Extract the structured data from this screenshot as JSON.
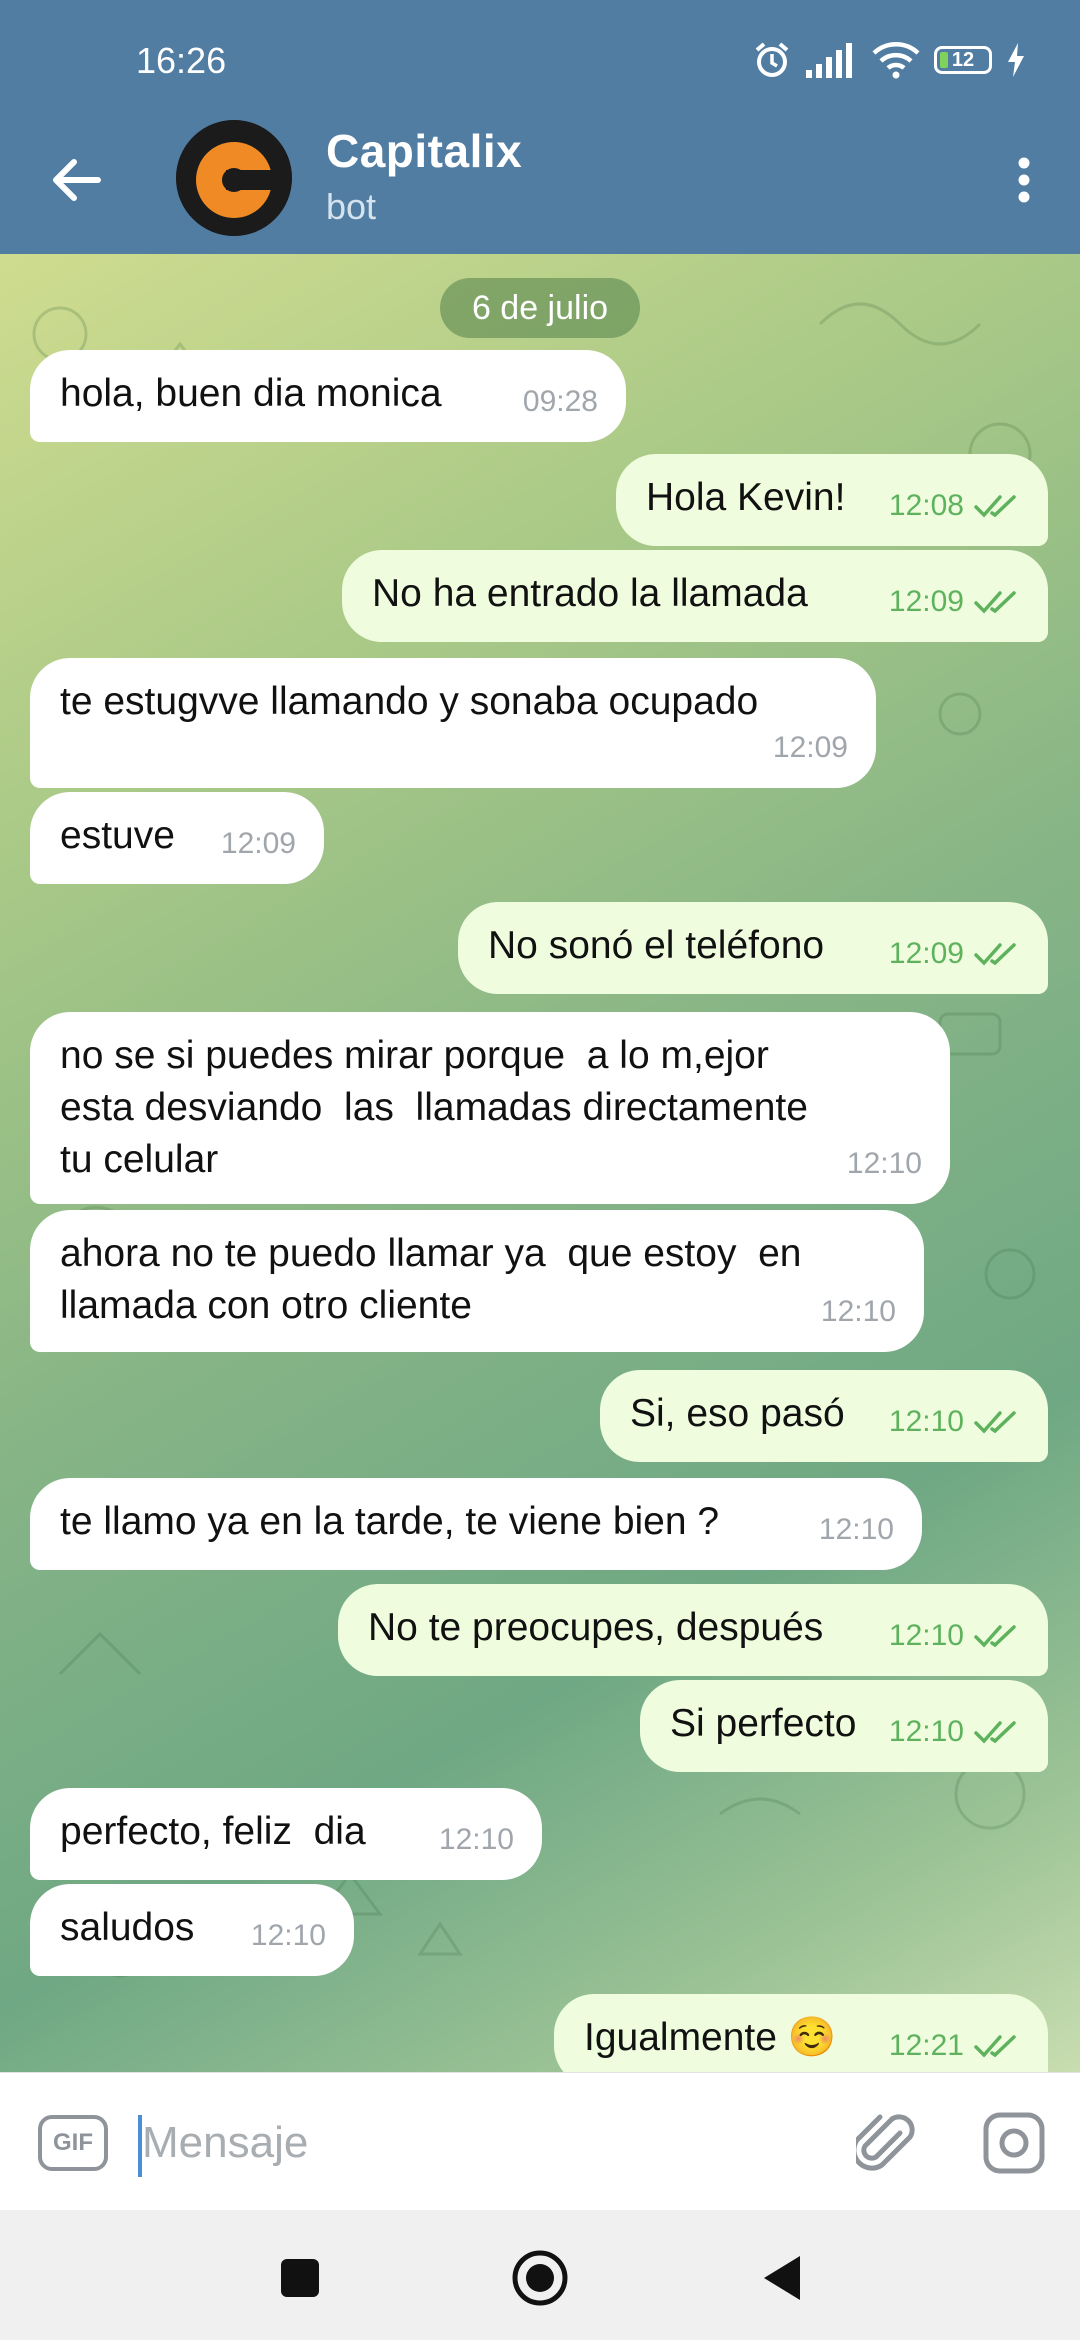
{
  "status_bar": {
    "time": "16:26",
    "battery": "12",
    "icons": [
      "alarm-icon",
      "signal-icon",
      "wifi-icon",
      "battery-icon",
      "charging-icon"
    ]
  },
  "header": {
    "title": "Capitalix",
    "subtitle": "bot",
    "back_icon": "arrow-left-icon",
    "menu_icon": "more-vertical-icon",
    "accent": "#517da2"
  },
  "chat": {
    "date": "6 de julio",
    "messages": [
      {
        "dir": "in",
        "text": "hola, buen dia monica",
        "time": "09:28"
      },
      {
        "dir": "out",
        "text": "Hola Kevin!",
        "time": "12:08",
        "read": true
      },
      {
        "dir": "out",
        "text": "No ha entrado la llamada",
        "time": "12:09",
        "read": true
      },
      {
        "dir": "in",
        "text": "te estugvve llamando y sonaba ocupado",
        "time": "12:09"
      },
      {
        "dir": "in",
        "text": "estuve",
        "time": "12:09"
      },
      {
        "dir": "out",
        "text": "No sonó el teléfono",
        "time": "12:09",
        "read": true
      },
      {
        "dir": "in",
        "text": "no se si puedes mirar porque  a lo m,ejor\nesta desviando  las  llamadas directamente\ntu celular",
        "time": "12:10"
      },
      {
        "dir": "in",
        "text": "ahora no te puedo llamar ya  que estoy  en\nllamada con otro cliente",
        "time": "12:10"
      },
      {
        "dir": "out",
        "text": "Si, eso pasó",
        "time": "12:10",
        "read": true
      },
      {
        "dir": "in",
        "text": "te llamo ya en la tarde, te viene bien ?",
        "time": "12:10"
      },
      {
        "dir": "out",
        "text": "No te preocupes, después",
        "time": "12:10",
        "read": true
      },
      {
        "dir": "out",
        "text": "Si perfecto",
        "time": "12:10",
        "read": true
      },
      {
        "dir": "in",
        "text": "perfecto, feliz  dia",
        "time": "12:10"
      },
      {
        "dir": "in",
        "text": "saludos",
        "time": "12:10"
      },
      {
        "dir": "out",
        "text": "Igualmente ☺️",
        "time": "12:21",
        "read": true
      }
    ]
  },
  "input": {
    "placeholder": "Mensaje",
    "value": "",
    "gif_label": "GIF"
  },
  "colors": {
    "incoming_bubble": "#ffffff",
    "outgoing_bubble": "#effdde",
    "outgoing_meta": "#5fb25d",
    "incoming_meta": "#a0a6ab"
  }
}
